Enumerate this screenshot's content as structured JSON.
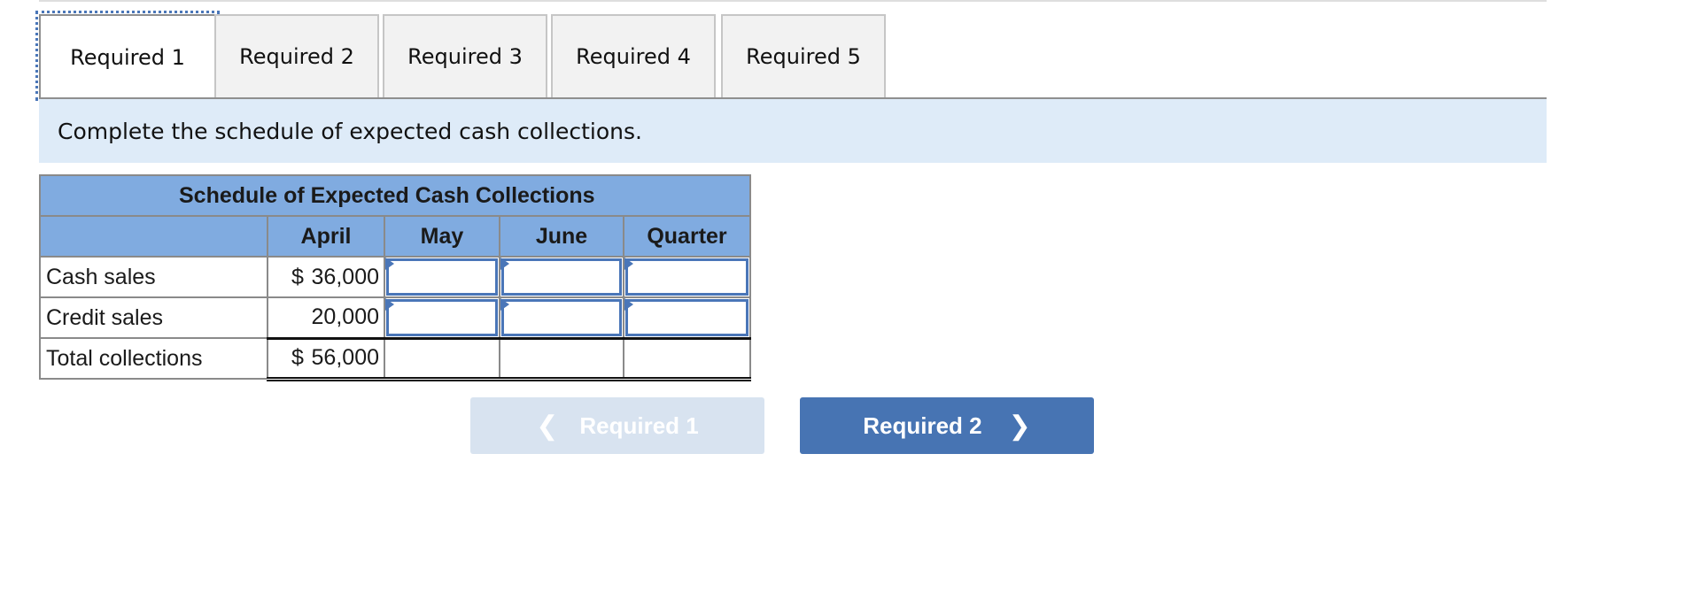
{
  "tabs": [
    {
      "label": "Required 1",
      "active": true
    },
    {
      "label": "Required 2",
      "active": false
    },
    {
      "label": "Required 3",
      "active": false
    },
    {
      "label": "Required 4",
      "active": false
    },
    {
      "label": "Required 5",
      "active": false
    }
  ],
  "instruction": "Complete the schedule of expected cash collections.",
  "schedule": {
    "title": "Schedule of Expected Cash Collections",
    "columns": [
      "April",
      "May",
      "June",
      "Quarter"
    ],
    "rows": [
      {
        "label": "Cash sales",
        "april_currency": "$",
        "april": "36,000",
        "may": "",
        "june": "",
        "quarter": ""
      },
      {
        "label": "Credit sales",
        "april_currency": "",
        "april": "20,000",
        "may": "",
        "june": "",
        "quarter": ""
      },
      {
        "label": "Total collections",
        "april_currency": "$",
        "april": "56,000",
        "may": "",
        "june": "",
        "quarter": ""
      }
    ]
  },
  "navigation": {
    "prev_label": "Required 1",
    "next_label": "Required 2",
    "prev_chevron": "❮",
    "next_chevron": "❯"
  },
  "colors": {
    "accent": "#4774b3",
    "table_header": "#80abe0",
    "instruction_bg": "#deebf8",
    "disabled_button": "#d8e3f0"
  }
}
